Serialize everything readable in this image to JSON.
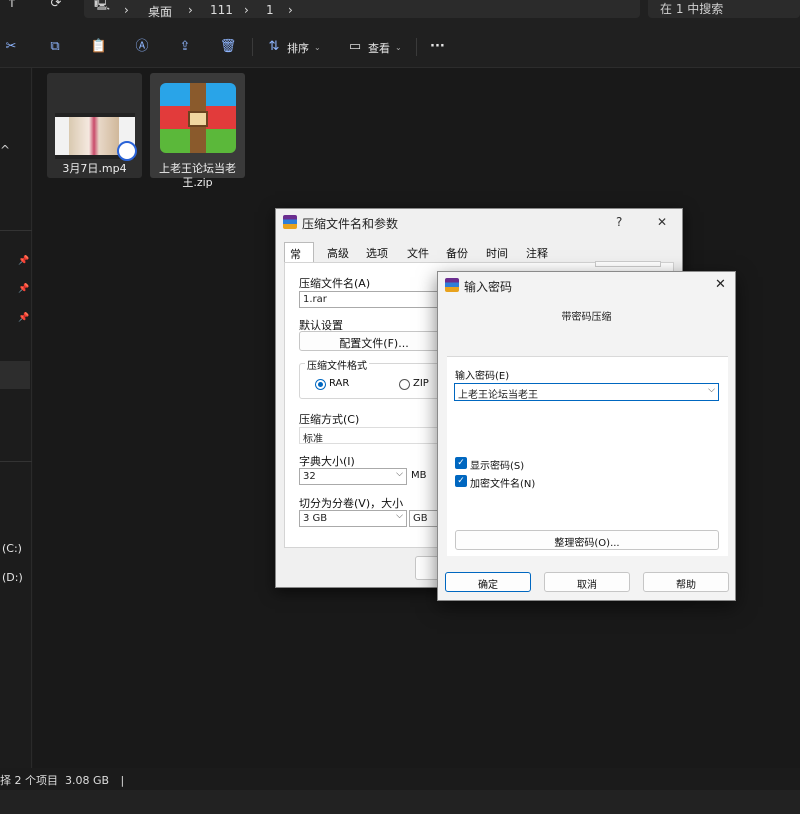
{
  "explorer": {
    "breadcrumbs": [
      "桌面",
      "111",
      "1"
    ],
    "search_placeholder": "在 1 中搜索",
    "toolbar": {
      "sort_label": "排序",
      "view_label": "查看",
      "more_label": "···"
    },
    "drives": [
      "(C:)",
      "(D:)"
    ],
    "files": [
      {
        "name": "3月7日.mp4",
        "icon": "video-thumbnail-icon"
      },
      {
        "name": "上老王论坛当老王.zip",
        "icon": "winrar-archive-icon"
      }
    ],
    "status_text": "择 2 个项目  3.08 GB"
  },
  "main_dialog": {
    "title": "压缩文件名和参数",
    "help_glyph": "?",
    "close_glyph": "✕",
    "tabs": [
      "常规",
      "高级",
      "选项",
      "文件",
      "备份",
      "时间",
      "注释"
    ],
    "archive_name_label": "压缩文件名(A)",
    "archive_name_value": "1.rar",
    "default_settings_label": "默认设置",
    "profiles_button": "配置文件(F)...",
    "format_group_label": "压缩文件格式",
    "format_rar": "RAR",
    "format_zip": "ZIP",
    "method_label": "压缩方式(C)",
    "method_value": "标准",
    "dict_label": "字典大小(I)",
    "dict_value": "32",
    "dict_unit": "MB",
    "split_label": "切分为分卷(V)，大小",
    "split_value": "3 GB",
    "split_unit": "GB"
  },
  "password_dialog": {
    "title": "输入密码",
    "close_glyph": "✕",
    "heading": "带密码压缩",
    "password_label": "输入密码(E)",
    "password_value": "上老王论坛当老王",
    "show_password_label": "显示密码(S)",
    "encrypt_names_label": "加密文件名(N)",
    "organize_button": "整理密码(O)...",
    "ok_button": "确定",
    "cancel_button": "取消",
    "help_button": "帮助"
  },
  "colors": {
    "accent": "#0067c0",
    "explorer_bg": "#191919",
    "dialog_bg": "#f0f0f0"
  }
}
